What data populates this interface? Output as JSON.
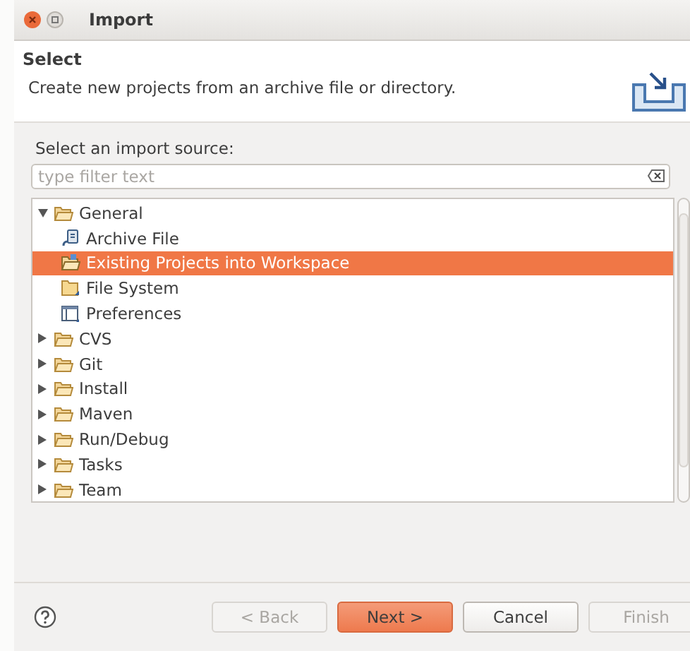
{
  "window": {
    "title": "Import"
  },
  "header": {
    "title": "Select",
    "description": "Create new projects from an archive file or directory."
  },
  "source_label": "Select an import source:",
  "filter": {
    "placeholder": "type filter text"
  },
  "tree": [
    {
      "label": "General",
      "kind": "folder",
      "expanded": true,
      "selected": false,
      "children": [
        {
          "label": "Archive File",
          "kind": "archive",
          "selected": false
        },
        {
          "label": "Existing Projects into Workspace",
          "kind": "project",
          "selected": true
        },
        {
          "label": "File System",
          "kind": "filesystem",
          "selected": false
        },
        {
          "label": "Preferences",
          "kind": "preferences",
          "selected": false
        }
      ]
    },
    {
      "label": "CVS",
      "kind": "folder",
      "expanded": false,
      "selected": false
    },
    {
      "label": "Git",
      "kind": "folder",
      "expanded": false,
      "selected": false
    },
    {
      "label": "Install",
      "kind": "folder",
      "expanded": false,
      "selected": false
    },
    {
      "label": "Maven",
      "kind": "folder",
      "expanded": false,
      "selected": false
    },
    {
      "label": "Run/Debug",
      "kind": "folder",
      "expanded": false,
      "selected": false
    },
    {
      "label": "Tasks",
      "kind": "folder",
      "expanded": false,
      "selected": false
    },
    {
      "label": "Team",
      "kind": "folder",
      "expanded": false,
      "selected": false
    }
  ],
  "buttons": [
    {
      "label": "< Back",
      "disabled": true,
      "default": false
    },
    {
      "label": "Next >",
      "disabled": false,
      "default": true
    },
    {
      "label": "Cancel",
      "disabled": false,
      "default": false
    },
    {
      "label": "Finish",
      "disabled": true,
      "default": false
    }
  ]
}
